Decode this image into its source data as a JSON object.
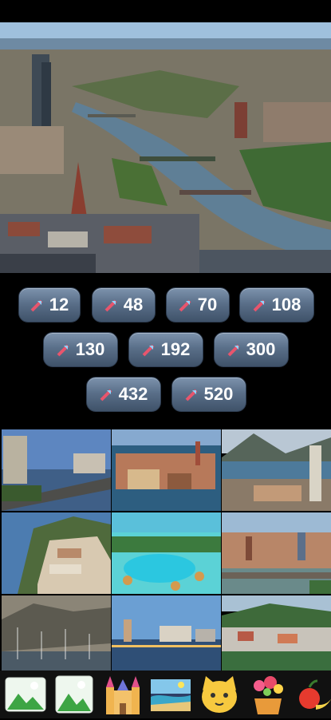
{
  "hero": {
    "scene": "city-river-aerial"
  },
  "piece_options": [
    {
      "value": "12"
    },
    {
      "value": "48"
    },
    {
      "value": "70"
    },
    {
      "value": "108"
    },
    {
      "value": "130"
    },
    {
      "value": "192"
    },
    {
      "value": "300"
    },
    {
      "value": "432"
    },
    {
      "value": "520"
    }
  ],
  "puzzle_images": [
    {
      "name": "coastal-skyline"
    },
    {
      "name": "harbor-old-town"
    },
    {
      "name": "bay-town-mountains"
    },
    {
      "name": "cliffside-village"
    },
    {
      "name": "resort-pool"
    },
    {
      "name": "river-bridge-city"
    },
    {
      "name": "marina-hillside"
    },
    {
      "name": "waterfront-skyline"
    },
    {
      "name": "lakeside-village"
    }
  ],
  "categories": [
    {
      "icon": "landscape-icon"
    },
    {
      "icon": "landscape-icon"
    },
    {
      "icon": "castle-icon"
    },
    {
      "icon": "beach-icon"
    },
    {
      "icon": "cat-icon"
    },
    {
      "icon": "flower-pot-icon"
    },
    {
      "icon": "fruit-icon"
    }
  ],
  "colors": {
    "chip_top": "#7d93ad",
    "chip_bottom": "#3f5269",
    "puzzle_arrow": "#e8556d"
  }
}
